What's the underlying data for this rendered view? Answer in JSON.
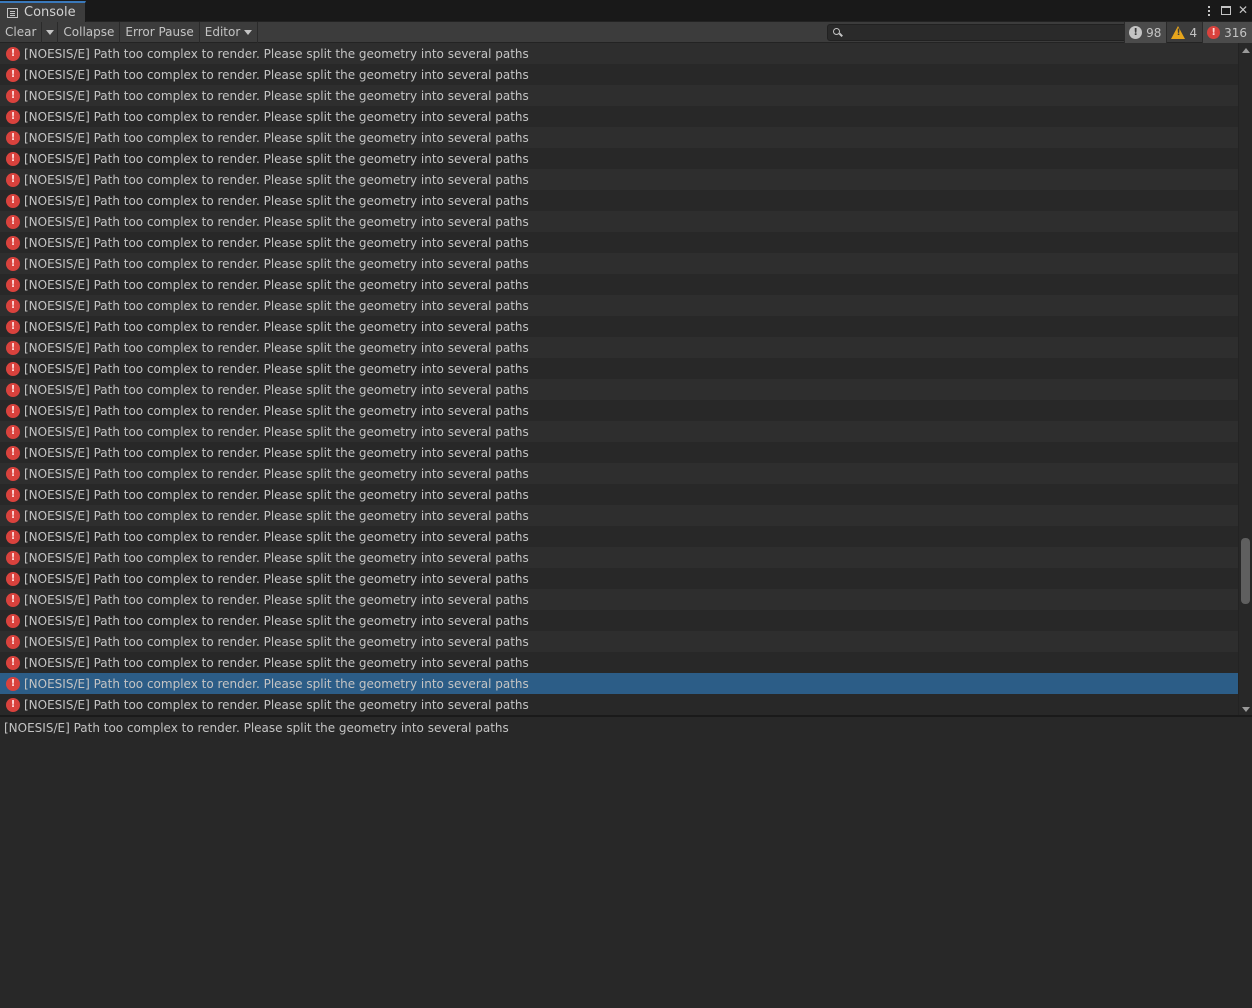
{
  "tab": {
    "title": "Console"
  },
  "toolbar": {
    "clear_label": "Clear",
    "collapse_label": "Collapse",
    "error_pause_label": "Error Pause",
    "editor_label": "Editor",
    "search_placeholder": "",
    "counts": {
      "info": "98",
      "warning": "4",
      "error": "316"
    }
  },
  "log": {
    "entries": [
      "[NOESIS/E] Path too complex to render. Please split the geometry into several paths",
      "[NOESIS/E] Path too complex to render. Please split the geometry into several paths",
      "[NOESIS/E] Path too complex to render. Please split the geometry into several paths",
      "[NOESIS/E] Path too complex to render. Please split the geometry into several paths",
      "[NOESIS/E] Path too complex to render. Please split the geometry into several paths",
      "[NOESIS/E] Path too complex to render. Please split the geometry into several paths",
      "[NOESIS/E] Path too complex to render. Please split the geometry into several paths",
      "[NOESIS/E] Path too complex to render. Please split the geometry into several paths",
      "[NOESIS/E] Path too complex to render. Please split the geometry into several paths",
      "[NOESIS/E] Path too complex to render. Please split the geometry into several paths",
      "[NOESIS/E] Path too complex to render. Please split the geometry into several paths",
      "[NOESIS/E] Path too complex to render. Please split the geometry into several paths",
      "[NOESIS/E] Path too complex to render. Please split the geometry into several paths",
      "[NOESIS/E] Path too complex to render. Please split the geometry into several paths",
      "[NOESIS/E] Path too complex to render. Please split the geometry into several paths",
      "[NOESIS/E] Path too complex to render. Please split the geometry into several paths",
      "[NOESIS/E] Path too complex to render. Please split the geometry into several paths",
      "[NOESIS/E] Path too complex to render. Please split the geometry into several paths",
      "[NOESIS/E] Path too complex to render. Please split the geometry into several paths",
      "[NOESIS/E] Path too complex to render. Please split the geometry into several paths",
      "[NOESIS/E] Path too complex to render. Please split the geometry into several paths",
      "[NOESIS/E] Path too complex to render. Please split the geometry into several paths",
      "[NOESIS/E] Path too complex to render. Please split the geometry into several paths",
      "[NOESIS/E] Path too complex to render. Please split the geometry into several paths",
      "[NOESIS/E] Path too complex to render. Please split the geometry into several paths",
      "[NOESIS/E] Path too complex to render. Please split the geometry into several paths",
      "[NOESIS/E] Path too complex to render. Please split the geometry into several paths",
      "[NOESIS/E] Path too complex to render. Please split the geometry into several paths",
      "[NOESIS/E] Path too complex to render. Please split the geometry into several paths",
      "[NOESIS/E] Path too complex to render. Please split the geometry into several paths",
      "[NOESIS/E] Path too complex to render. Please split the geometry into several paths",
      "[NOESIS/E] Path too complex to render. Please split the geometry into several paths",
      "[NOESIS/E] Path too complex to render. Please split the geometry into several paths"
    ],
    "selected_index": 30
  },
  "detail": {
    "text": "[NOESIS/E] Path too complex to render. Please split the geometry into several paths"
  }
}
